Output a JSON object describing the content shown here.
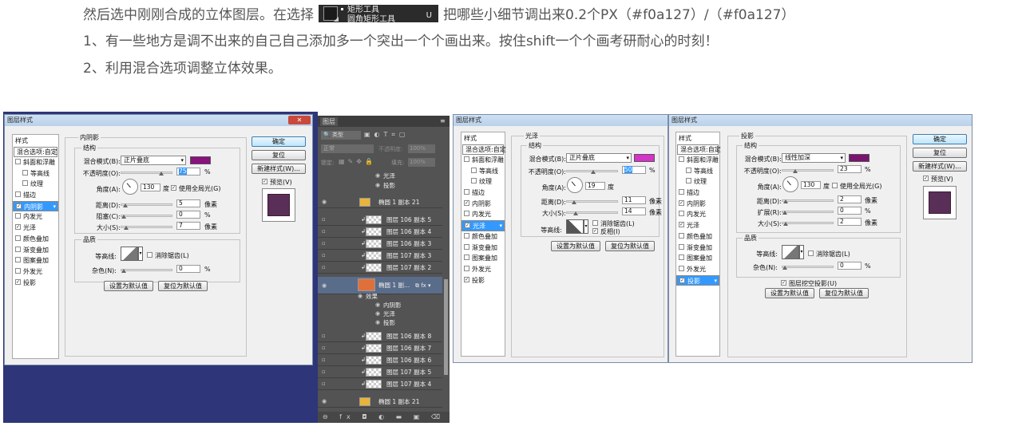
{
  "article": {
    "line1_before": "然后选中刚刚合成的立体图层。在选择",
    "line1_after": "把哪些小细节调出来0.2个PX（#f0a127）/（#f0a127）",
    "line2": "1、有一些地方是调不出来的自己自己添加多一个突出一个个画出来。按住shift一个个画考研耐心的时刻！",
    "line3": "2、利用混合选项调整立体效果。",
    "tool_item1": "矩形工具",
    "tool_item2": "圆角矩形工具",
    "tool_key": "U"
  },
  "common": {
    "dialog_title": "图层样式",
    "close": "✕",
    "styles_header": "样式",
    "blend_options": "混合选项:自定",
    "styles": [
      "斜面和浮雕",
      "等高线",
      "纹理",
      "描边",
      "内阴影",
      "内发光",
      "光泽",
      "颜色叠加",
      "渐变叠加",
      "图案叠加",
      "外发光",
      "投影"
    ],
    "ok": "确定",
    "reset": "复位",
    "new_style": "新建样式(W)...",
    "preview": "预览(V)",
    "structure": "结构",
    "quality": "品质",
    "blend_mode_label": "混合模式(B):",
    "opacity_label": "不透明度(O):",
    "angle_label": "角度(A):",
    "distance_label": "距离(D):",
    "size_label": "大小(S):",
    "contour_label": "等高线:",
    "antialias": "消除锯齿(L)",
    "noise_label": "杂色(N):",
    "make_default": "设置为默认值",
    "reset_default": "复位为默认值",
    "degree": "度",
    "pixel": "像素",
    "percent": "%"
  },
  "inner_shadow": {
    "section": "内阴影",
    "blend_mode": "正片叠底",
    "color": "#8b1080",
    "opacity": "75",
    "angle": "130",
    "global_light": "使用全局光(G)",
    "distance": "5",
    "choke_label": "阻塞(C):",
    "choke": "0",
    "size": "7",
    "noise": "0"
  },
  "satin": {
    "section": "光泽",
    "blend_mode": "正片叠底",
    "color": "#d633c8",
    "opacity": "50",
    "angle": "19",
    "distance": "11",
    "size": "14",
    "invert": "反相(I)"
  },
  "drop_shadow": {
    "section": "投影",
    "blend_mode": "线性加深",
    "color": "#7a1470",
    "opacity": "23",
    "angle": "130",
    "global_light": "使用全局光(G)",
    "distance": "2",
    "spread_label": "扩展(R):",
    "spread": "0",
    "size": "2",
    "noise": "0",
    "knockout": "图层挖空投影(U)"
  },
  "layers": {
    "tab": "图层",
    "kind": "类型",
    "mode": "正常",
    "opacity_label": "不透明度:",
    "opacity": "100%",
    "lock_label": "锁定:",
    "fill_label": "填充:",
    "fill": "100%",
    "rows": [
      {
        "name": "光泽",
        "kind": "fx"
      },
      {
        "name": "投影",
        "kind": "fx"
      },
      {
        "name": "椭圆 1 副本 21",
        "kind": "shape"
      },
      {
        "name": "图层 106 副本 5",
        "kind": "layer"
      },
      {
        "name": "图层 106 副本 4",
        "kind": "layer"
      },
      {
        "name": "图层 106 副本 3",
        "kind": "layer"
      },
      {
        "name": "图层 107 副本 3",
        "kind": "layer"
      },
      {
        "name": "图层 107 副本 2",
        "kind": "layer"
      },
      {
        "name": "椭圆 1 副...",
        "kind": "selected"
      },
      {
        "name": "效果",
        "kind": "fx"
      },
      {
        "name": "内阴影",
        "kind": "fx"
      },
      {
        "name": "光泽",
        "kind": "fx"
      },
      {
        "name": "投影",
        "kind": "fx"
      },
      {
        "name": "图层 106 副本 8",
        "kind": "layer"
      },
      {
        "name": "图层 106 副本 7",
        "kind": "layer"
      },
      {
        "name": "图层 106 副本 6",
        "kind": "layer"
      },
      {
        "name": "图层 107 副本 5",
        "kind": "layer"
      },
      {
        "name": "图层 107 副本 4",
        "kind": "layer"
      },
      {
        "name": "椭圆 1 副本 21",
        "kind": "shape"
      }
    ],
    "bottom_icons": "⊖ fx ◘ ◐ ▬ ▣ ⌫"
  }
}
